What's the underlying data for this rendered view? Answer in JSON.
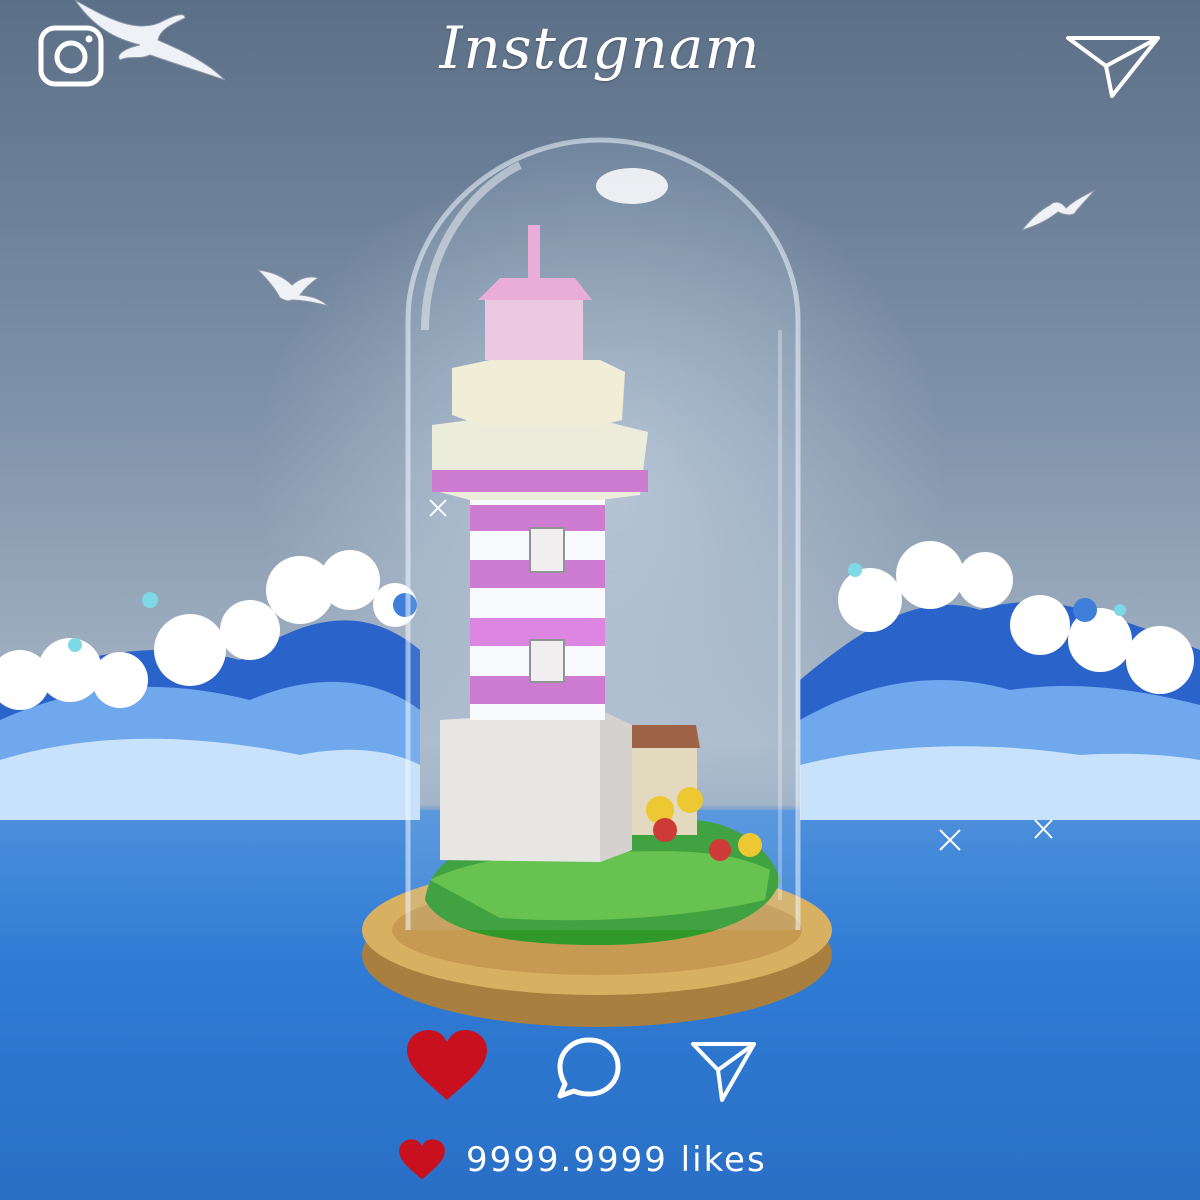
{
  "header": {
    "title": "Instagnam",
    "left_icon": "camera-icon",
    "right_icon": "send-icon"
  },
  "actions": [
    {
      "name": "like",
      "icon": "heart-icon",
      "color": "#c8101e"
    },
    {
      "name": "comment",
      "icon": "comment-icon",
      "color": "#ffffff"
    },
    {
      "name": "share",
      "icon": "send-icon",
      "color": "#ffffff"
    }
  ],
  "likes": {
    "icon": "heart-icon",
    "text": "9999.9999 likes"
  },
  "colors": {
    "heart": "#c8101e",
    "icon_stroke": "#ffffff",
    "floor_blue": "#2f79d2",
    "wave_blue": "#2a63c9"
  }
}
